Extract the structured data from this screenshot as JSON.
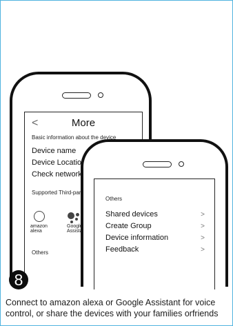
{
  "back_screen": {
    "nav_back_icon": "chevron-left-icon",
    "nav_back_glyph": "<",
    "title": "More",
    "subtitle": "Basic information about the device",
    "items": [
      "Device name",
      "Device Location",
      "Check network"
    ],
    "third_party_label": "Supported Third-party Control",
    "services": [
      {
        "label": "amazon alexa",
        "icon": "alexa-ring-icon"
      },
      {
        "label": "Google Assistant",
        "icon": "google-assistant-icon"
      }
    ],
    "others_label": "Others"
  },
  "front_screen": {
    "others_label": "Others",
    "items": [
      {
        "label": "Shared devices",
        "chevron": ">"
      },
      {
        "label": "Create Group",
        "chevron": ">"
      },
      {
        "label": "Device information",
        "chevron": ">"
      },
      {
        "label": "Feedback",
        "chevron": ">"
      }
    ]
  },
  "step": {
    "number": "8",
    "caption": "Connect  to amazon alexa or Google Assistant for voice control, or share the devices with your families orfriends"
  },
  "colors": {
    "frame_border": "#4fb3df",
    "badge_bg": "#0d0d0d"
  }
}
